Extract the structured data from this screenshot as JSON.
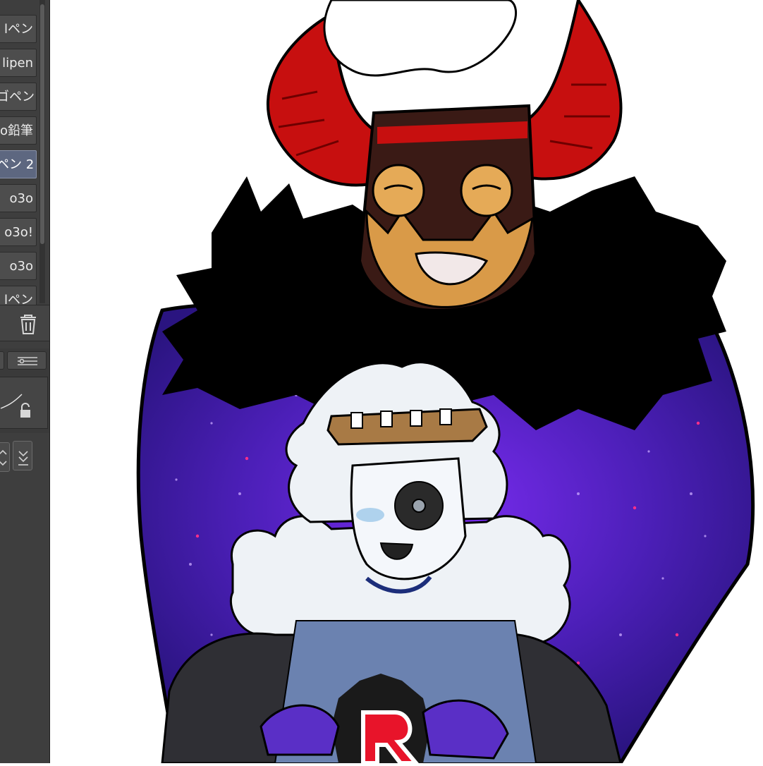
{
  "brush_panel": {
    "items": [
      {
        "label": "lペン"
      },
      {
        "label": "lipen"
      },
      {
        "label": "ゴペン"
      },
      {
        "label": "o鉛筆"
      },
      {
        "label": "ペン 2"
      },
      {
        "label": "o3o"
      },
      {
        "label": "o3o!"
      },
      {
        "label": "o3o"
      },
      {
        "label": "lペン"
      }
    ],
    "selected_index": 4
  },
  "colors": {
    "panel_bg": "#3e3e3e",
    "selected_item": "#5d6780",
    "horn_red": "#c70f0f",
    "mask_brown": "#3a1a15",
    "skin_orange": "#d99a48",
    "galaxy_purple": "#4a1fb0",
    "fur_black": "#000000",
    "coat_blue": "#6b82b0",
    "crown_brown": "#a87a45"
  },
  "icons": [
    "trash-icon",
    "layers-icon",
    "lock-icon",
    "chevrons-icon",
    "stepper-icon"
  ]
}
